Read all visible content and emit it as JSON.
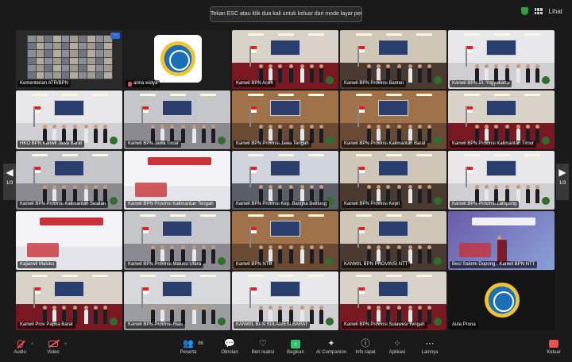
{
  "banner": {
    "text": "Tekan ESC atau klik dua kali untuk keluar dari mode layar penuh"
  },
  "top": {
    "view_label": "Lihat"
  },
  "gallery": {
    "page_left": "1/3",
    "page_right": "1/3",
    "tiles": [
      {
        "name": "Kementerian ATR/BPN",
        "scene": "thumbs"
      },
      {
        "name": "arina widya",
        "scene": "logo",
        "mic_off": true
      },
      {
        "name": "Kanwil BPN Aceh",
        "scene": "red"
      },
      {
        "name": "Kanwil BPN Provinsi Banten",
        "scene": "hall"
      },
      {
        "name": "Kanwil BPN Di. Yogyakarta",
        "scene": "white"
      },
      {
        "name": "HKO BPN Kanwil Jawa Barat",
        "scene": "white"
      },
      {
        "name": "Kanwil BPN Jawa Timur",
        "scene": "grey"
      },
      {
        "name": "Kanwil BPN Provinsi Jawa Tengah",
        "scene": "wood"
      },
      {
        "name": "Kanwil BPN Provinsi Kalimantan Barat",
        "scene": "wood"
      },
      {
        "name": "Kanwil BPN Provinsi Kalimantan Timur",
        "scene": "red"
      },
      {
        "name": "Kanwil BPN Provinsi Kalimantan Selatan",
        "scene": "grey"
      },
      {
        "name": "Kanwil BPN Provinsi Kalimantan Tengah",
        "scene": "slide"
      },
      {
        "name": "Kanwil BPN Provinsi Kep. Bangka Belitung",
        "scene": "blue"
      },
      {
        "name": "Kanwil BPN Provinsi Kepri",
        "scene": "hall"
      },
      {
        "name": "Kanwil BPN Provinsi Lampung",
        "scene": "white"
      },
      {
        "name": "Kajiarwil Maluku",
        "scene": "slide"
      },
      {
        "name": "Kanwil BPN Provinsi Maluku Utara",
        "scene": "grey"
      },
      {
        "name": "Kanwil BPN NTB",
        "scene": "wood"
      },
      {
        "name": "KANWIL BPN PROVINSI NTT",
        "scene": "hall"
      },
      {
        "name": "Beci Salomi Dopong . Kanwil BPN NTT",
        "scene": "slide2"
      },
      {
        "name": "Kanwil Prov Papua Barat",
        "scene": "red"
      },
      {
        "name": "Kanwil BPN Provinsi Riau",
        "scene": "crowd"
      },
      {
        "name": "KANWIL BPN SULAWESI BARAT",
        "scene": "white"
      },
      {
        "name": "Kanwil BPN Provinsi Sulawesi Tengah",
        "scene": "red"
      },
      {
        "name": "Aula Prona",
        "scene": "logo_dark"
      }
    ]
  },
  "toolbar": {
    "audio": "Audio",
    "video": "Video",
    "participants": "Peserta",
    "participants_count": "86",
    "chat": "Obrolan",
    "reactions": "Beri reaksi",
    "share": "Bagikan",
    "ai": "AI Companion",
    "info": "Info rapat",
    "apps": "Aplikasi",
    "more": "Lainnya",
    "leave": "Keluar"
  },
  "colors": {
    "active_border": "#2ecc71",
    "share_green": "#35c16f",
    "leave_red": "#e5534b"
  }
}
